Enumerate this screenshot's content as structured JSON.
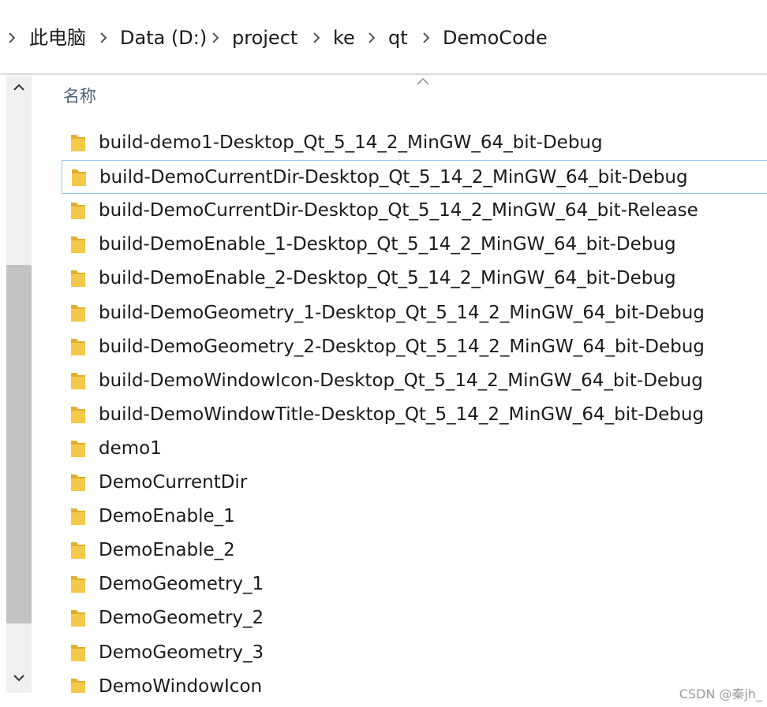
{
  "breadcrumb": {
    "items": [
      "此电脑",
      "Data (D:)",
      "project",
      "ke",
      "qt",
      "DemoCode"
    ]
  },
  "columns": {
    "name_header": "名称"
  },
  "files": [
    "build-demo1-Desktop_Qt_5_14_2_MinGW_64_bit-Debug",
    "build-DemoCurrentDir-Desktop_Qt_5_14_2_MinGW_64_bit-Debug",
    "build-DemoCurrentDir-Desktop_Qt_5_14_2_MinGW_64_bit-Release",
    "build-DemoEnable_1-Desktop_Qt_5_14_2_MinGW_64_bit-Debug",
    "build-DemoEnable_2-Desktop_Qt_5_14_2_MinGW_64_bit-Debug",
    "build-DemoGeometry_1-Desktop_Qt_5_14_2_MinGW_64_bit-Debug",
    "build-DemoGeometry_2-Desktop_Qt_5_14_2_MinGW_64_bit-Debug",
    "build-DemoWindowIcon-Desktop_Qt_5_14_2_MinGW_64_bit-Debug",
    "build-DemoWindowTitle-Desktop_Qt_5_14_2_MinGW_64_bit-Debug",
    "demo1",
    "DemoCurrentDir",
    "DemoEnable_1",
    "DemoEnable_2",
    "DemoGeometry_1",
    "DemoGeometry_2",
    "DemoGeometry_3",
    "DemoWindowIcon"
  ],
  "watermark": "CSDN @秦jh_",
  "icons": {
    "folder": "folder-icon",
    "chevron": "chevron-right-icon",
    "scroll_up": "chevron-up-icon",
    "scroll_down": "chevron-down-icon"
  },
  "colors": {
    "folder": "#f3c94a",
    "focus_border": "#99c9ef",
    "header_text": "#4c607a",
    "scroll_thumb": "#c2c2c2"
  }
}
